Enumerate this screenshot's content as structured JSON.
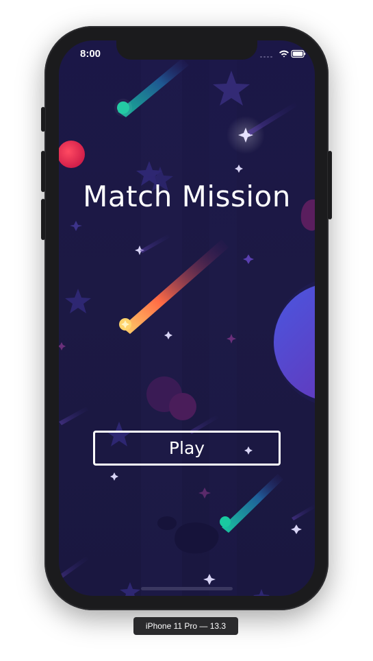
{
  "status_bar": {
    "time": "8:00"
  },
  "game": {
    "title": "Match Mission",
    "play_label": "Play"
  },
  "simulator": {
    "device_label": "iPhone 11 Pro — 13.3"
  },
  "colors": {
    "screen_bg": "#1b1747",
    "text": "#ffffff",
    "device_frame": "#1b1b1d"
  }
}
